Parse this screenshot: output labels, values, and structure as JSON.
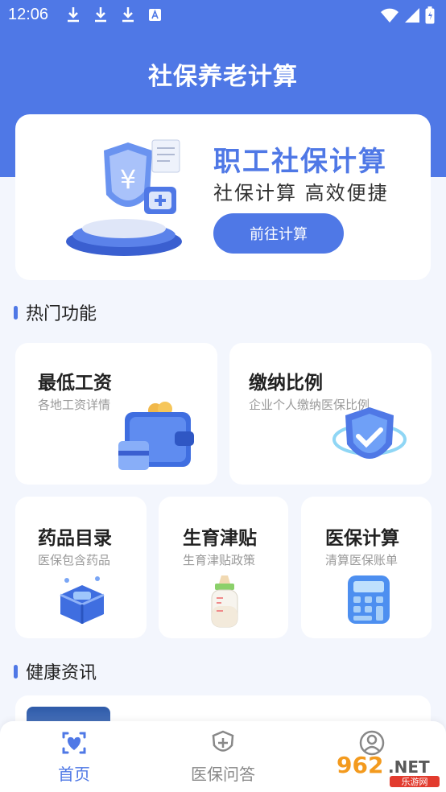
{
  "status_bar": {
    "time": "12:06"
  },
  "app_title": "社保养老计算",
  "hero": {
    "title": "职工社保计算",
    "subtitle": "社保计算 高效便捷",
    "button_label": "前往计算"
  },
  "sections": {
    "hot": "热门功能",
    "news": "健康资讯"
  },
  "features": [
    {
      "title": "最低工资",
      "subtitle": "各地工资详情",
      "icon": "wallet-icon"
    },
    {
      "title": "缴纳比例",
      "subtitle": "企业个人缴纳医保比例",
      "icon": "shield-check-icon"
    },
    {
      "title": "药品目录",
      "subtitle": "医保包含药品",
      "icon": "medicine-box-icon"
    },
    {
      "title": "生育津贴",
      "subtitle": "生育津贴政策",
      "icon": "baby-bottle-icon"
    },
    {
      "title": "医保计算",
      "subtitle": "清算医保账单",
      "icon": "calculator-icon"
    }
  ],
  "tabbar": [
    {
      "label": "首页",
      "icon": "home-heart-icon",
      "active": true
    },
    {
      "label": "医保问答",
      "icon": "shield-plus-icon",
      "active": false
    },
    {
      "label": "",
      "icon": "user-icon",
      "active": false
    }
  ],
  "watermark": {
    "text": "962.NET",
    "sub": "乐游网"
  },
  "colors": {
    "primary": "#4f78e6",
    "background": "#f3f6fd"
  }
}
